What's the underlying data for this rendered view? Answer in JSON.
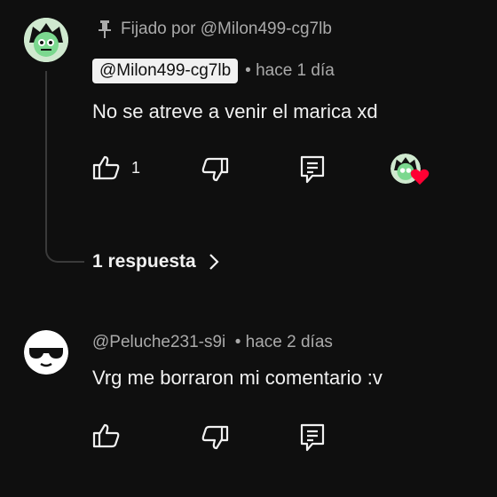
{
  "comments": [
    {
      "pinned_label": "Fijado por @Milon499-cg7lb",
      "author": "@Milon499-cg7lb",
      "time": "• hace 1 día",
      "text": "No se atreve a venir el marica xd",
      "like_count": "1",
      "replies_label": "1 respuesta"
    },
    {
      "author": "@Peluche231-s9i",
      "time": "• hace 2 días",
      "text": "Vrg me borraron mi comentario :v"
    }
  ],
  "colors": {
    "background": "#0f0f0f",
    "text": "#f1f1f1",
    "muted": "#aaaaaa",
    "heart": "#ff0033",
    "avatar_green": "#7bd88f"
  },
  "icons": [
    "pin-icon",
    "thumbs-up-icon",
    "thumbs-down-icon",
    "reply-icon",
    "creator-heart-icon",
    "chevron-right-icon"
  ]
}
